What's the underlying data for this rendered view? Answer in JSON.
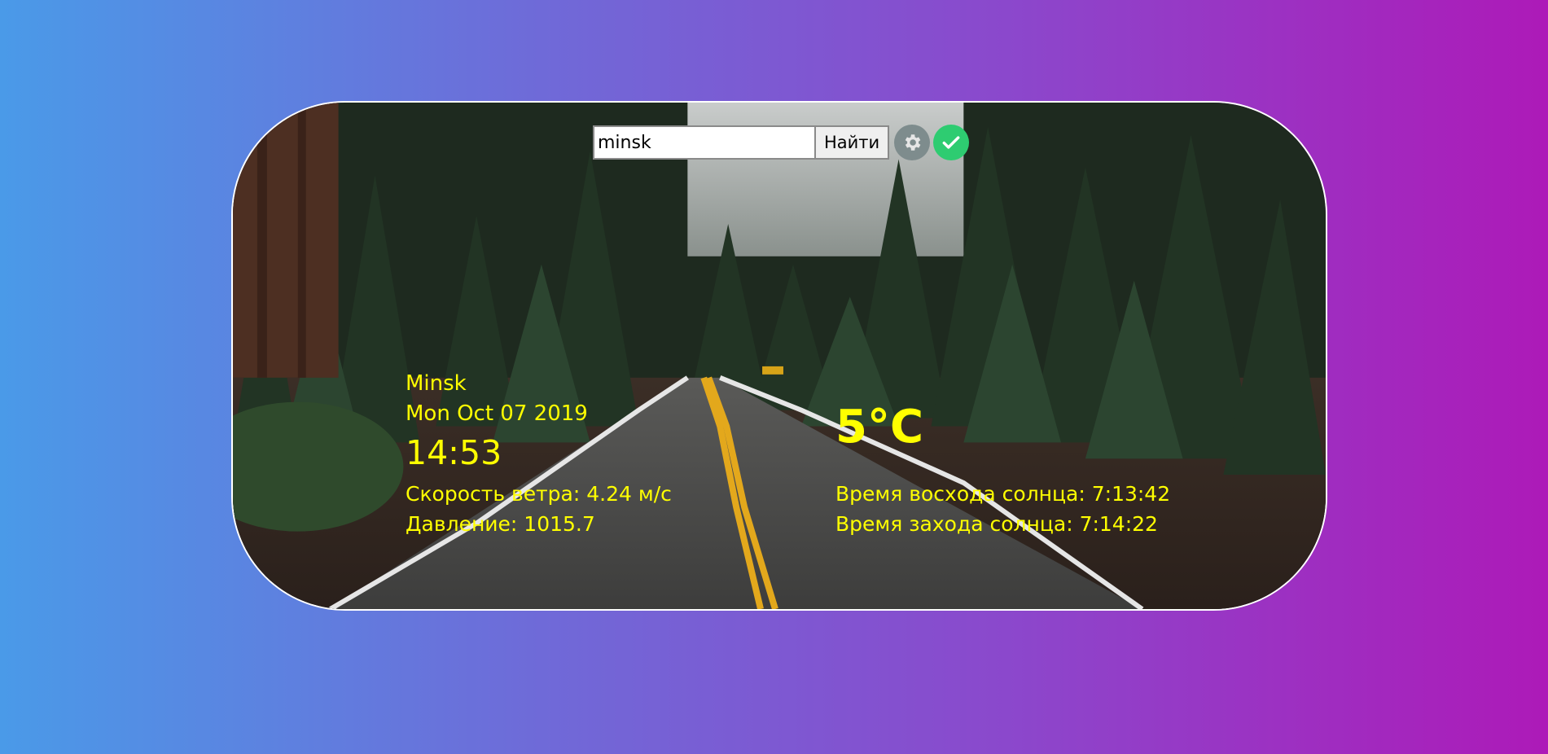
{
  "search": {
    "value": "minsk",
    "button_label": "Найти"
  },
  "icons": {
    "settings": "gear-icon",
    "confirm": "check-icon"
  },
  "colors": {
    "text_accent": "#ffff00",
    "gear_bg": "#7e8c8d",
    "check_bg": "#2ecc71"
  },
  "weather": {
    "city": "Minsk",
    "date": "Mon Oct 07 2019",
    "time": "14:53",
    "wind": "Скорость ветра: 4.24 м/с",
    "pressure": "Давление: 1015.7",
    "temperature": "5°C",
    "sunrise": "Время восхода солнца: 7:13:42",
    "sunset": "Время захода солнца: 7:14:22"
  }
}
